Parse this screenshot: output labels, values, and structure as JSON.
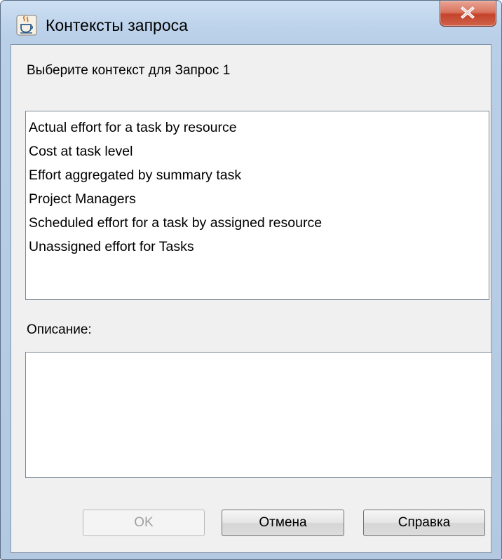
{
  "window": {
    "title": "Контексты запроса",
    "app_icon": "java-icon",
    "close_icon": "close-icon"
  },
  "dialog": {
    "prompt": "Выберите контекст для Запрос 1",
    "contexts": [
      "Actual effort for a task by resource",
      "Cost at task level",
      "Effort aggregated by summary task",
      "Project Managers",
      "Scheduled effort for a task by assigned resource",
      "Unassigned effort for Tasks"
    ],
    "description_label": "Описание:",
    "description_value": ""
  },
  "buttons": {
    "ok": "OK",
    "cancel": "Отмена",
    "help": "Справка"
  },
  "colors": {
    "frame": "#b9cfe7",
    "client": "#f0f0f0",
    "close": "#c4422a",
    "disabled_text": "#a0a0a0"
  }
}
